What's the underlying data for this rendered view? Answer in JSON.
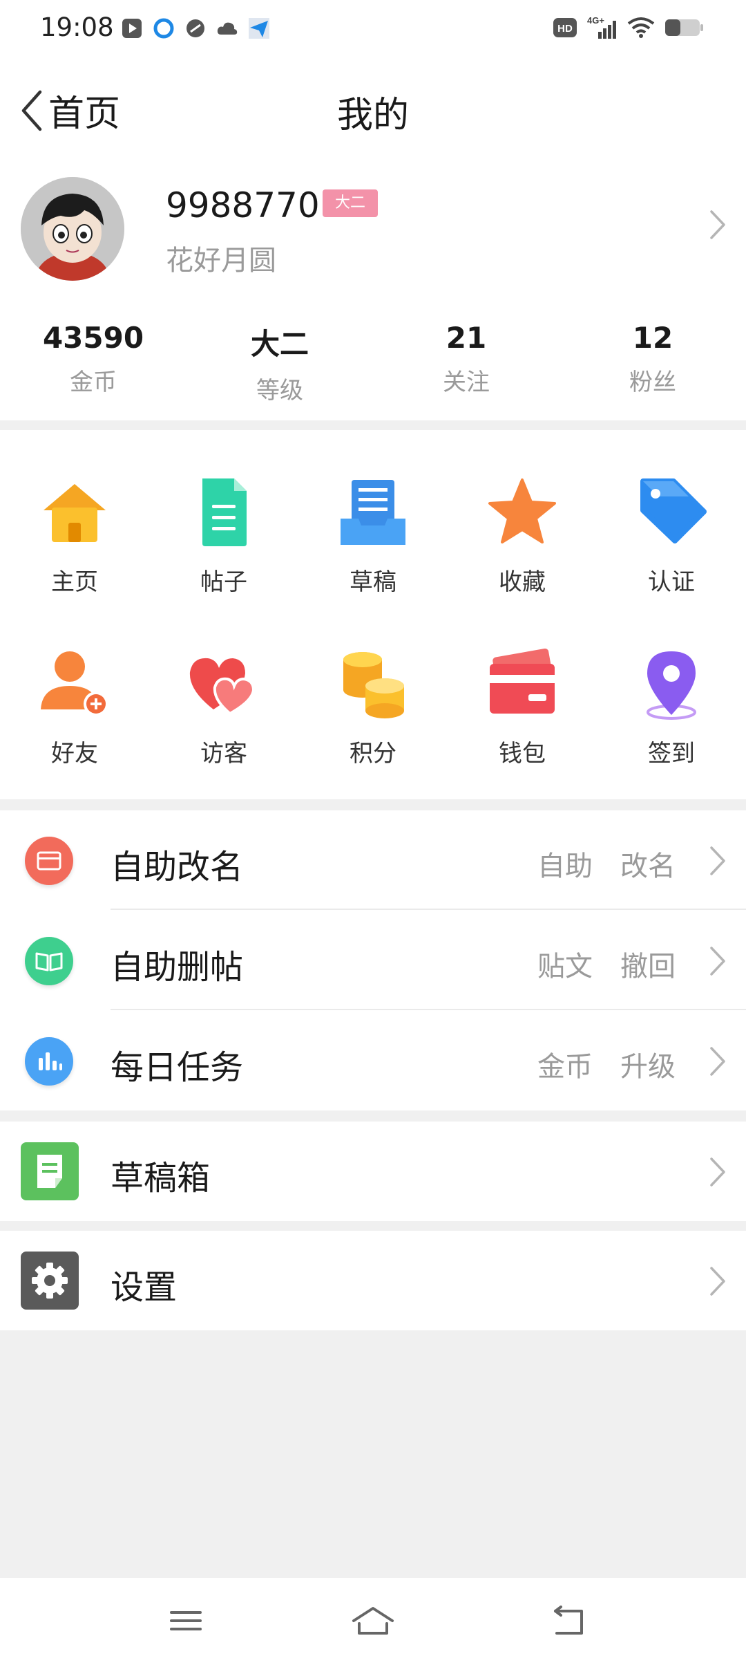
{
  "status": {
    "time": "19:08",
    "network": "4G+",
    "hd": "HD"
  },
  "nav": {
    "back_label": "首页",
    "title": "我的"
  },
  "profile": {
    "username": "9988770’",
    "level_badge": "大二",
    "signature": "花好月圆",
    "stats": [
      {
        "value": "43590",
        "label": "金币"
      },
      {
        "value": "大二",
        "label": "等级"
      },
      {
        "value": "21",
        "label": "关注"
      },
      {
        "value": "12",
        "label": "粉丝"
      }
    ]
  },
  "grid": {
    "items": [
      {
        "label": "主页",
        "icon": "home-icon"
      },
      {
        "label": "帖子",
        "icon": "document-icon"
      },
      {
        "label": "草稿",
        "icon": "draft-inbox-icon"
      },
      {
        "label": "收藏",
        "icon": "star-icon"
      },
      {
        "label": "认证",
        "icon": "tag-icon"
      },
      {
        "label": "好友",
        "icon": "add-friend-icon"
      },
      {
        "label": "访客",
        "icon": "hearts-icon"
      },
      {
        "label": "积分",
        "icon": "coins-icon"
      },
      {
        "label": "钱包",
        "icon": "wallet-card-icon"
      },
      {
        "label": "签到",
        "icon": "location-pin-icon"
      }
    ]
  },
  "menu": {
    "rows": [
      {
        "title": "自助改名",
        "hint": "自助　改名",
        "icon": "card-icon",
        "color": "#f26b5b"
      },
      {
        "title": "自助删帖",
        "hint": "贴文　撤回",
        "icon": "book-icon",
        "color": "#3ecf8e"
      },
      {
        "title": "每日任务",
        "hint": "金币　升级",
        "icon": "bar-chart-icon",
        "color": "#4aa3f5"
      }
    ]
  },
  "drafts": {
    "title": "草稿箱",
    "icon": "note-icon",
    "color": "#5cc15e"
  },
  "settings": {
    "title": "设置",
    "icon": "gear-icon",
    "color": "#5a5a5a"
  },
  "colors": {
    "accent_pink": "#f392a9",
    "page_bg": "#f0f0f0",
    "secondary_text": "#9a9a9a"
  }
}
